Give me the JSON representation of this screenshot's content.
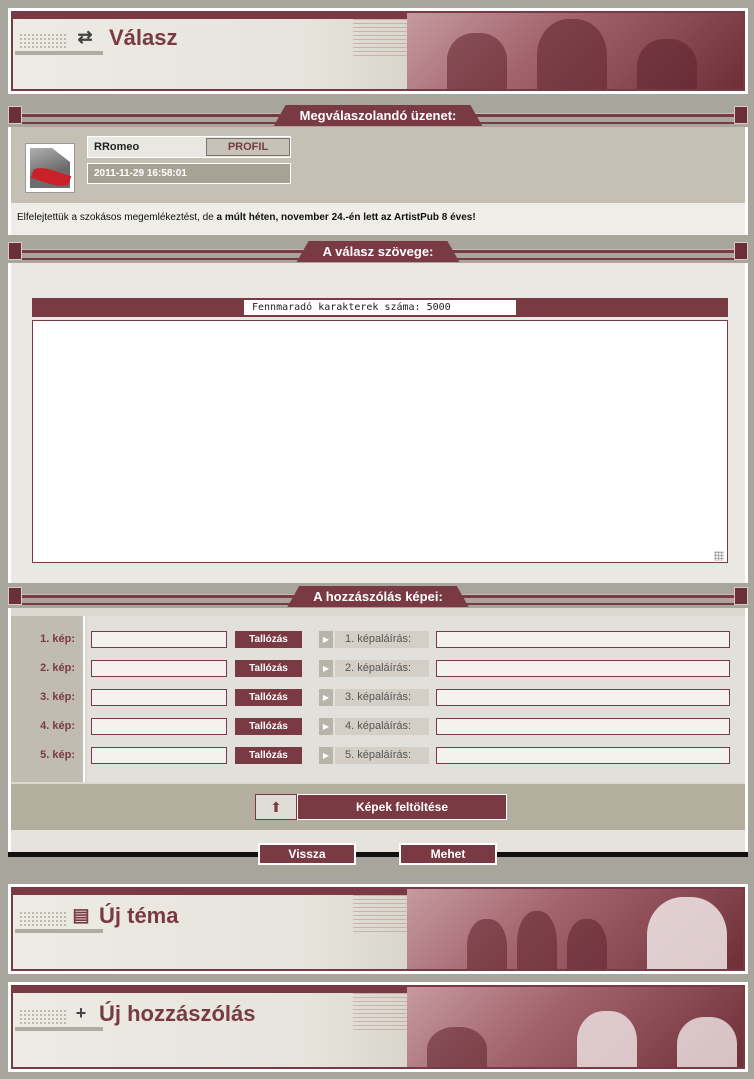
{
  "header": {
    "title": "Válasz",
    "icon": "reply-arrows-icon"
  },
  "message_section": {
    "caption": "Megválaszolandó üzenet:",
    "username": "RRomeo",
    "profile_button": "PROFIL",
    "datetime": "2011-11-29 16:58:01",
    "text_part1": "Elfelejtettük a szokásos megemlékeztést, de ",
    "text_part2": "a múlt héten, november 24.-én lett az ArtistPub 8 éves!"
  },
  "reply_section": {
    "caption": "A válasz szövege:",
    "char_counter": "Fennmaradó karakterek száma: 5000",
    "textarea_value": ""
  },
  "images_section": {
    "caption": "A hozzászólás képei:",
    "rows": [
      {
        "label": "1. kép:",
        "browse": "Tallózás",
        "caption_label": "1. képaláírás:"
      },
      {
        "label": "2. kép:",
        "browse": "Tallózás",
        "caption_label": "2. képaláírás:"
      },
      {
        "label": "3. kép:",
        "browse": "Tallózás",
        "caption_label": "3. képaláírás:"
      },
      {
        "label": "4. kép:",
        "browse": "Tallózás",
        "caption_label": "4. képaláírás:"
      },
      {
        "label": "5. kép:",
        "browse": "Tallózás",
        "caption_label": "5. képaláírás:"
      }
    ],
    "upload_button": "Képek feltöltése"
  },
  "actions": {
    "back": "Vissza",
    "submit": "Mehet"
  },
  "banners": [
    {
      "title": "Új téma",
      "icon": "folder-icon"
    },
    {
      "title": "Új hozzászólás",
      "icon": "plus-icon"
    }
  ],
  "colors": {
    "accent": "#7a3a44",
    "panel": "#c4c0b4",
    "background": "#a7a59c"
  }
}
